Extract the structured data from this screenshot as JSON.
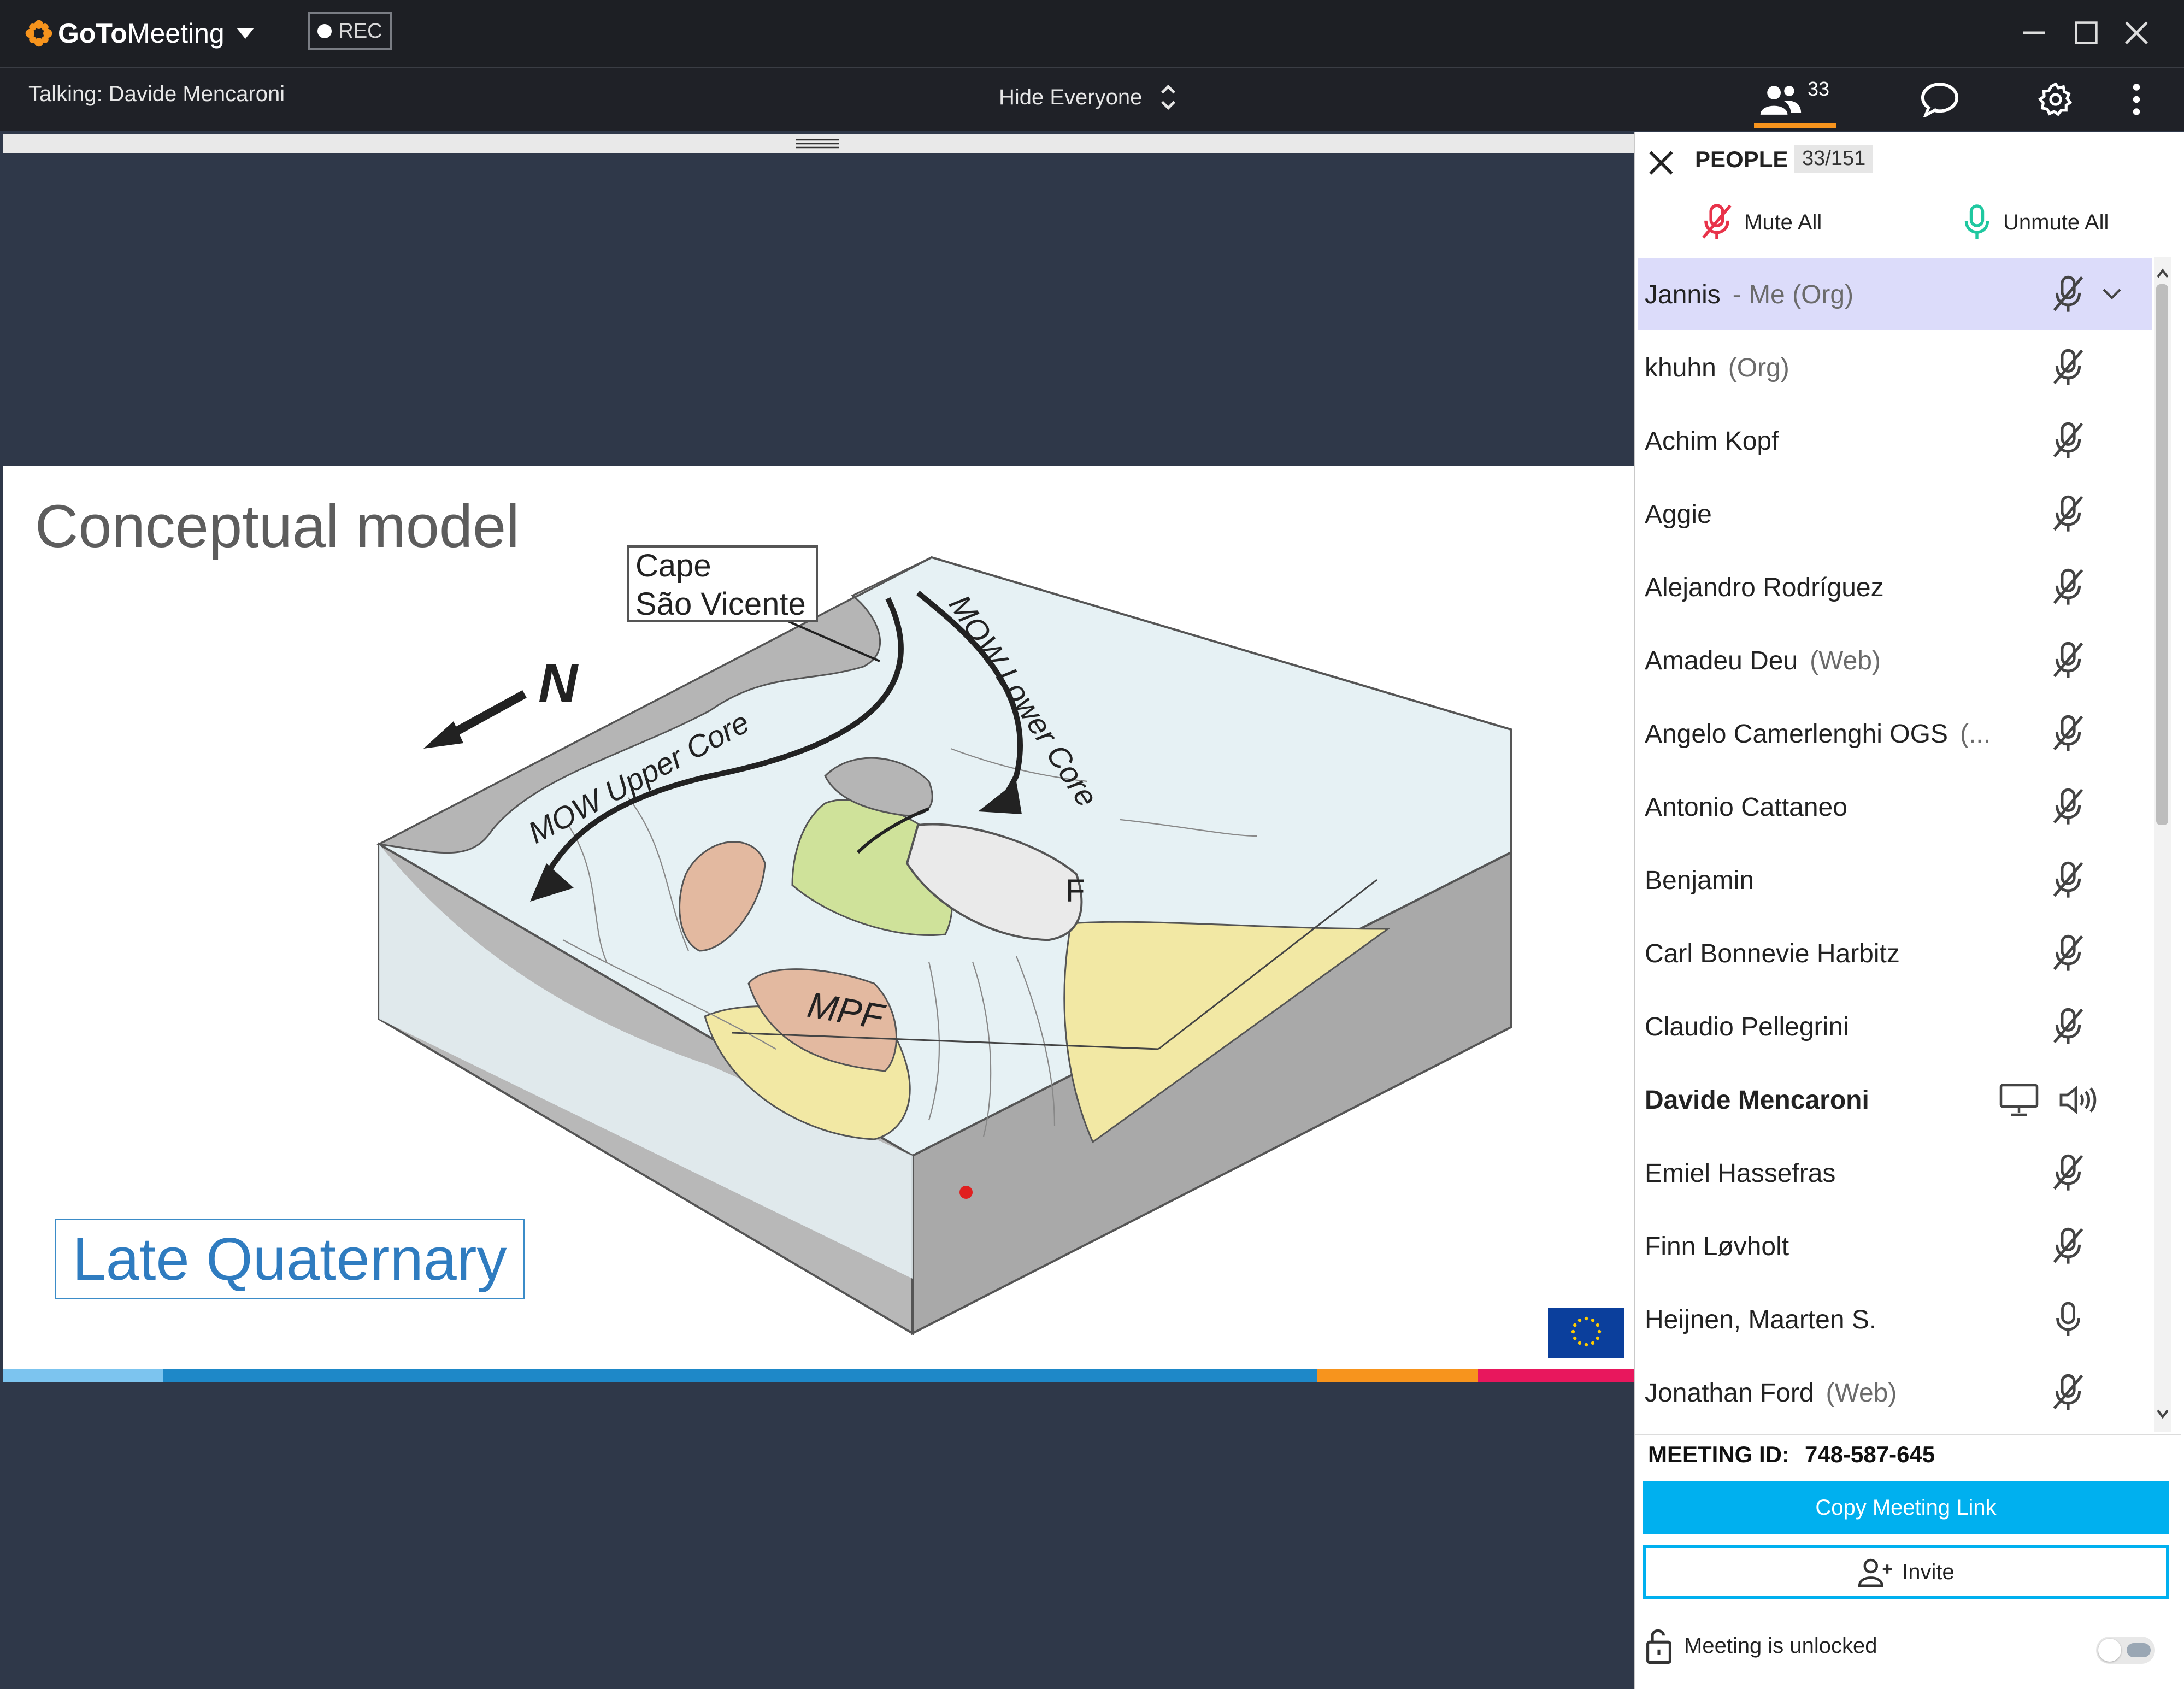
{
  "app": {
    "brand_go": "GoTo",
    "brand_meeting": "Meeting",
    "rec_label": "REC"
  },
  "toolbar": {
    "talking": "Talking: Davide Mencaroni",
    "hide_everyone": "Hide Everyone",
    "people_count": "33"
  },
  "slide": {
    "title": "Conceptual model",
    "badge": "Late Quaternary",
    "labels": {
      "cape_line1": "Cape",
      "cape_line2": "São Vicente",
      "north": "N",
      "upper_core": "MOW Upper Core",
      "lower_core": "MOW Lower Core",
      "mpf": "MPF",
      "f": "F"
    },
    "stripe_colors": [
      "#7cc4ef",
      "#1e88c8",
      "#f7941d",
      "#e8175d"
    ]
  },
  "panel": {
    "title": "PEOPLE",
    "count": "33/151",
    "mute_all": "Mute All",
    "unmute_all": "Unmute All",
    "participants": [
      {
        "name": "Jannis",
        "tag": "- Me (Org)",
        "icon": "muted-mic-icon",
        "selected": true
      },
      {
        "name": "khuhn",
        "tag": "(Org)",
        "icon": "muted-mic-icon"
      },
      {
        "name": "Achim Kopf",
        "tag": "",
        "icon": "muted-mic-icon"
      },
      {
        "name": "Aggie",
        "tag": "",
        "icon": "muted-mic-icon"
      },
      {
        "name": "Alejandro Rodríguez",
        "tag": "",
        "icon": "muted-mic-icon"
      },
      {
        "name": "Amadeu Deu",
        "tag": "(Web)",
        "icon": "muted-mic-icon"
      },
      {
        "name": "Angelo Camerlenghi OGS",
        "tag": "(...",
        "icon": "muted-mic-icon"
      },
      {
        "name": "Antonio Cattaneo",
        "tag": "",
        "icon": "muted-mic-icon"
      },
      {
        "name": "Benjamin",
        "tag": "",
        "icon": "muted-mic-icon"
      },
      {
        "name": "Carl Bonnevie Harbitz",
        "tag": "",
        "icon": "muted-mic-icon"
      },
      {
        "name": "Claudio Pellegrini",
        "tag": "",
        "icon": "muted-mic-icon"
      },
      {
        "name": "Davide Mencaroni",
        "tag": "",
        "icon": "speaker-icon",
        "bold": true
      },
      {
        "name": "Emiel Hassefras",
        "tag": "",
        "icon": "muted-mic-icon"
      },
      {
        "name": "Finn Løvholt",
        "tag": "",
        "icon": "muted-mic-icon"
      },
      {
        "name": "Heijnen, Maarten S.",
        "tag": "",
        "icon": "mic-icon"
      },
      {
        "name": "Jonathan Ford",
        "tag": "(Web)",
        "icon": "muted-mic-icon"
      }
    ],
    "meeting_id_label": "MEETING ID:",
    "meeting_id": "748-587-645",
    "copy_link": "Copy Meeting Link",
    "invite": "Invite",
    "lock_status": "Meeting is unlocked"
  },
  "colors": {
    "accent": "#00b0ef",
    "selected_row": "#dcdcfa",
    "mute_red": "#e8334a",
    "unmute_green": "#1fc8a0",
    "people_tab_underline": "#f7941d"
  }
}
